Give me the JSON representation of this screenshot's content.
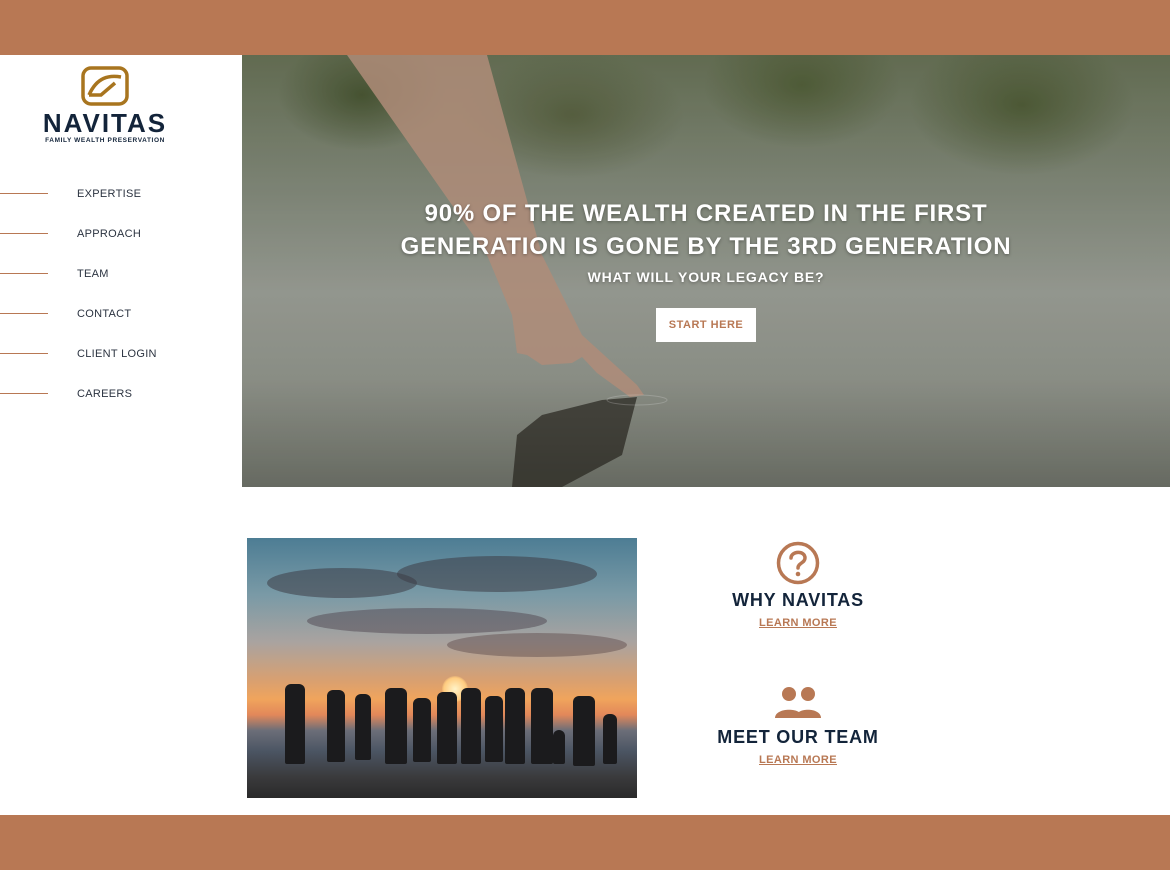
{
  "brand": {
    "name": "NAVITAS",
    "tagline": "FAMILY WEALTH PRESERVATION",
    "accent_color": "#b87854",
    "navy_color": "#13243a"
  },
  "nav": {
    "items": [
      {
        "label": "EXPERTISE"
      },
      {
        "label": "APPROACH"
      },
      {
        "label": "TEAM"
      },
      {
        "label": "CONTACT"
      },
      {
        "label": "CLIENT LOGIN"
      },
      {
        "label": "CAREERS"
      }
    ]
  },
  "hero": {
    "title_line1": "90% OF THE WEALTH CREATED IN THE FIRST",
    "title_line2": "GENERATION IS GONE BY THE 3RD GENERATION",
    "subtitle": "WHAT WILL YOUR LEGACY BE?",
    "cta_label": "START HERE"
  },
  "features": [
    {
      "icon": "question-circle-icon",
      "title": "WHY NAVITAS",
      "link": "LEARN MORE"
    },
    {
      "icon": "people-icon",
      "title": "MEET OUR TEAM",
      "link": "LEARN MORE"
    }
  ]
}
